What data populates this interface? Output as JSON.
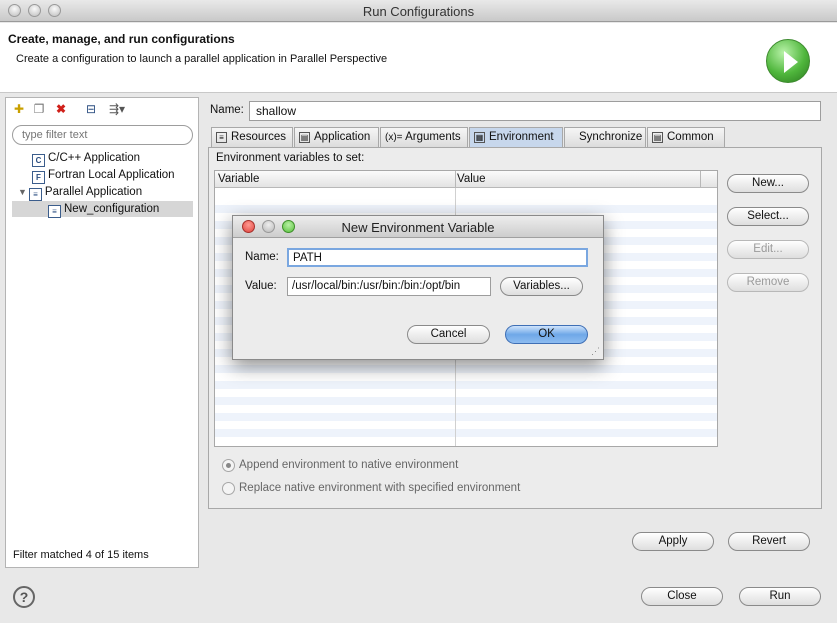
{
  "window": {
    "title": "Run Configurations"
  },
  "header": {
    "title": "Create, manage, and run configurations",
    "subtitle": "Create a configuration to launch a parallel application in Parallel Perspective"
  },
  "left": {
    "filter_placeholder": "type filter text",
    "tree": [
      {
        "label": "C/C++ Application",
        "icon": "c-app-icon",
        "glyph": "C"
      },
      {
        "label": "Fortran Local Application",
        "icon": "fortran-app-icon",
        "glyph": "F"
      },
      {
        "label": "Parallel Application",
        "icon": "parallel-app-icon",
        "glyph": "≡"
      },
      {
        "label": "New_configuration",
        "icon": "parallel-config-icon",
        "glyph": "≡"
      }
    ],
    "filter_status": "Filter matched 4 of 15 items"
  },
  "config": {
    "name_label": "Name:",
    "name_value": "shallow",
    "tabs": [
      {
        "label": "Resources",
        "glyph": "≡"
      },
      {
        "label": "Application",
        "glyph": "▤"
      },
      {
        "label": "Arguments",
        "glyph": "(x)="
      },
      {
        "label": "Environment",
        "glyph": "▦"
      },
      {
        "label": "Synchronize",
        "glyph": ""
      },
      {
        "label": "Common",
        "glyph": "▤"
      }
    ],
    "env_label": "Environment variables to set:",
    "columns": [
      "Variable",
      "Value"
    ],
    "buttons": {
      "new": "New...",
      "select": "Select...",
      "edit": "Edit...",
      "remove": "Remove"
    },
    "radio_append": "Append environment to native environment",
    "radio_replace": "Replace native environment with specified environment",
    "apply": "Apply",
    "revert": "Revert"
  },
  "footer": {
    "close": "Close",
    "run": "Run"
  },
  "dialog": {
    "title": "New Environment Variable",
    "name_label": "Name:",
    "name_value": "PATH",
    "value_label": "Value:",
    "value_value": "/usr/local/bin:/usr/bin:/bin:/opt/bin",
    "variables_button": "Variables...",
    "cancel": "Cancel",
    "ok": "OK"
  },
  "colors": {
    "accent": "#6fa8e8",
    "close_dot": "#e0443e",
    "min_dot": "#b8b8b8",
    "zoom_dot": "#58c13d"
  }
}
